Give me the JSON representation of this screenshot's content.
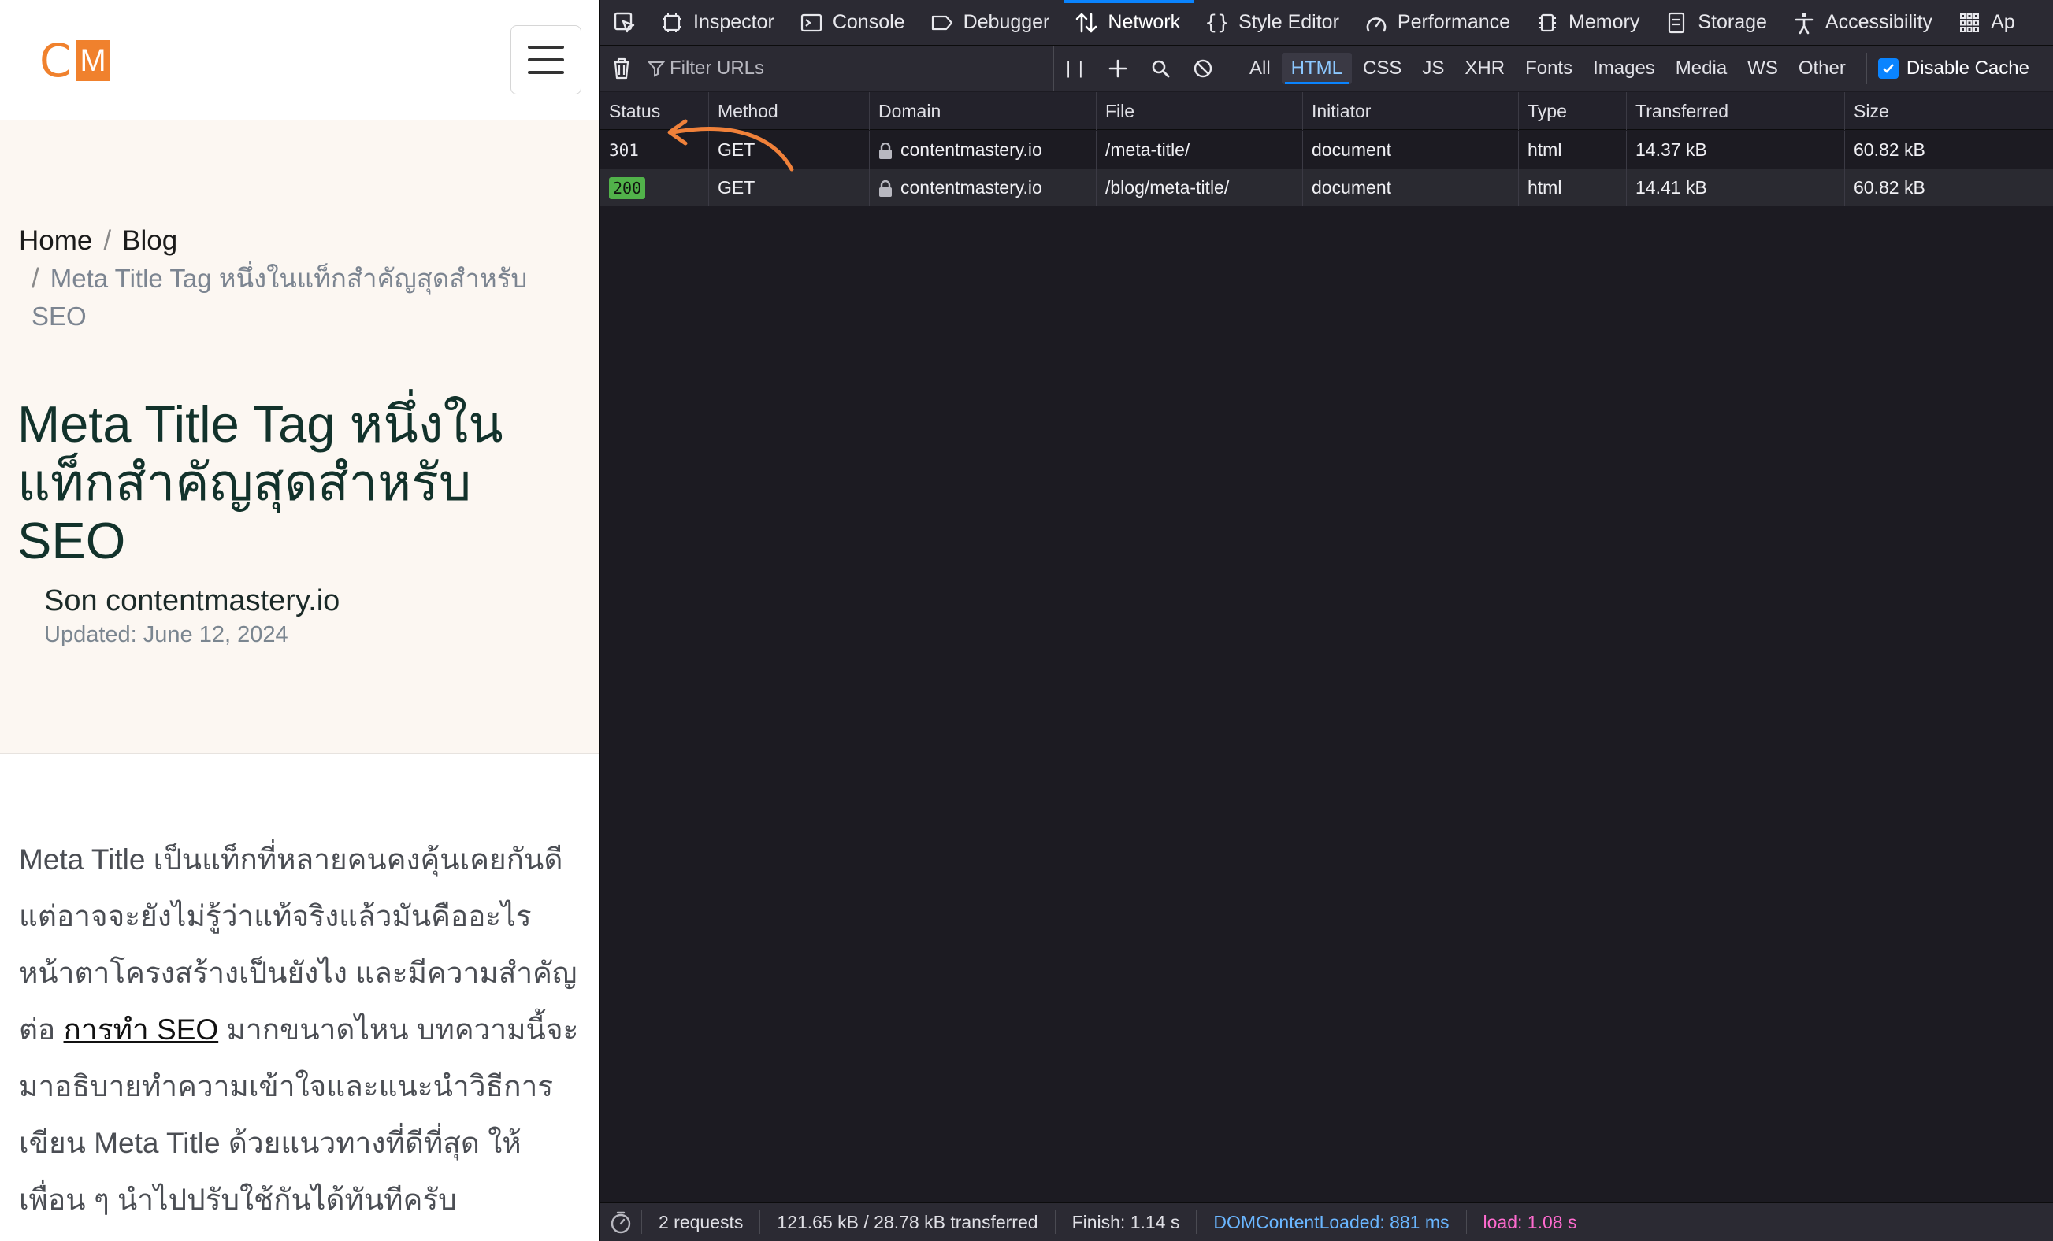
{
  "site": {
    "logo": {
      "c": "C",
      "m": "M"
    },
    "breadcrumb": {
      "home": "Home",
      "sep": "/",
      "blog": "Blog",
      "current": "Meta Title Tag หนึ่งในแท็กสำคัญสุดสำหรับ SEO"
    },
    "title": "Meta Title Tag หนึ่งในแท็กสำคัญสุดสำหรับ SEO",
    "author": "Son contentmastery.io",
    "updated": "Updated: June 12, 2024",
    "body": {
      "part1": "Meta Title เป็นแท็กที่หลายคนคงคุ้นเคยกันดี แต่อาจจะยังไม่รู้ว่าแท้จริงแล้วมันคืออะไร หน้าตาโครงสร้างเป็นยังไง และมีความสำคัญต่อ ",
      "link": "การทำ SEO",
      "part2": " มากขนาดไหน บทความนี้จะมาอธิบายทำความเข้าใจและแนะนำวิธีการเขียน Meta Title ด้วยแนวทางที่ดีที่สุด ให้เพื่อน ๆ นำไปปรับใช้กันได้ทันทีครับ"
    }
  },
  "devtools": {
    "tabs": [
      {
        "label": "Inspector",
        "icon": "inspector-icon"
      },
      {
        "label": "Console",
        "icon": "console-icon"
      },
      {
        "label": "Debugger",
        "icon": "debugger-icon"
      },
      {
        "label": "Network",
        "icon": "network-icon",
        "active": true
      },
      {
        "label": "Style Editor",
        "icon": "style-editor-icon"
      },
      {
        "label": "Performance",
        "icon": "performance-icon"
      },
      {
        "label": "Memory",
        "icon": "memory-icon"
      },
      {
        "label": "Storage",
        "icon": "storage-icon"
      },
      {
        "label": "Accessibility",
        "icon": "accessibility-icon"
      },
      {
        "label": "Ap",
        "icon": "apps-icon"
      }
    ],
    "toolbar": {
      "filter_placeholder": "Filter URLs",
      "filters": [
        "All",
        "HTML",
        "CSS",
        "JS",
        "XHR",
        "Fonts",
        "Images",
        "Media",
        "WS",
        "Other"
      ],
      "active_filter": "HTML",
      "pause_label": "| |",
      "disable_cache": "Disable Cache"
    },
    "columns": [
      "Status",
      "Method",
      "Domain",
      "File",
      "Initiator",
      "Type",
      "Transferred",
      "Size"
    ],
    "rows": [
      {
        "status": "301",
        "method": "GET",
        "domain": "contentmastery.io",
        "file": "/meta-title/",
        "initiator": "document",
        "type": "html",
        "transferred": "14.37 kB",
        "size": "60.82 kB"
      },
      {
        "status": "200",
        "method": "GET",
        "domain": "contentmastery.io",
        "file": "/blog/meta-title/",
        "initiator": "document",
        "type": "html",
        "transferred": "14.41 kB",
        "size": "60.82 kB"
      }
    ],
    "status_bar": {
      "requests": "2 requests",
      "transferred": "121.65 kB / 28.78 kB transferred",
      "finish": "Finish: 1.14 s",
      "dom_content_loaded": "DOMContentLoaded: 881 ms",
      "load": "load: 1.08 s"
    },
    "colors": {
      "accent": "#0a84ff",
      "ok_status": "#51b24a",
      "annotation_arrow": "#f0813a",
      "dcl": "#6ab6ff",
      "load": "#ff6bd0"
    }
  }
}
